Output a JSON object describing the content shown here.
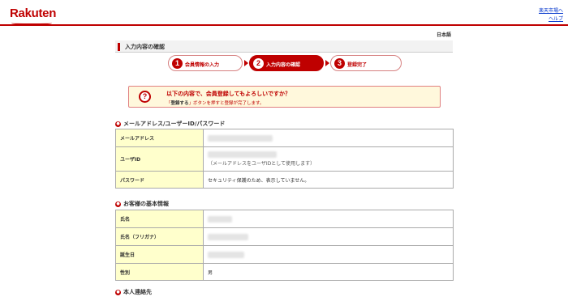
{
  "header": {
    "logo": "Rakuten",
    "links": [
      "楽天市場へ",
      "ヘルプ"
    ]
  },
  "language": "日本語",
  "page_title": "入力内容の確認",
  "steps": [
    {
      "num": "1",
      "label": "会員情報の入力"
    },
    {
      "num": "2",
      "label": "入力内容の確認"
    },
    {
      "num": "3",
      "label": "登録完了"
    }
  ],
  "confirm": {
    "icon": "question-icon",
    "main": "以下の内容で、会員登録してもよろしいですか？",
    "sub_prefix": "「",
    "sub_bold": "登録する",
    "sub_rest": "」ボタンを押すと登録が完了します。"
  },
  "sections": {
    "account": {
      "title": "メールアドレス/ユーザーID/パスワード",
      "rows": [
        {
          "label": "メールアドレス"
        },
        {
          "label": "ユーザID",
          "note": "（メールアドレスをユーザIDとして使用します）"
        },
        {
          "label": "パスワード",
          "value": "セキュリティ保護のため、表示していません。"
        }
      ]
    },
    "basic": {
      "title": "お客様の基本情報",
      "rows": [
        {
          "label": "氏名"
        },
        {
          "label": "氏名（フリガナ）"
        },
        {
          "label": "誕生日"
        },
        {
          "label": "性別",
          "value": "男"
        }
      ]
    },
    "contact": {
      "title": "本人連絡先"
    }
  },
  "colors": {
    "brand": "#bf0000",
    "label_bg": "#ffffcc",
    "confirm_bg": "#fff8dc"
  }
}
